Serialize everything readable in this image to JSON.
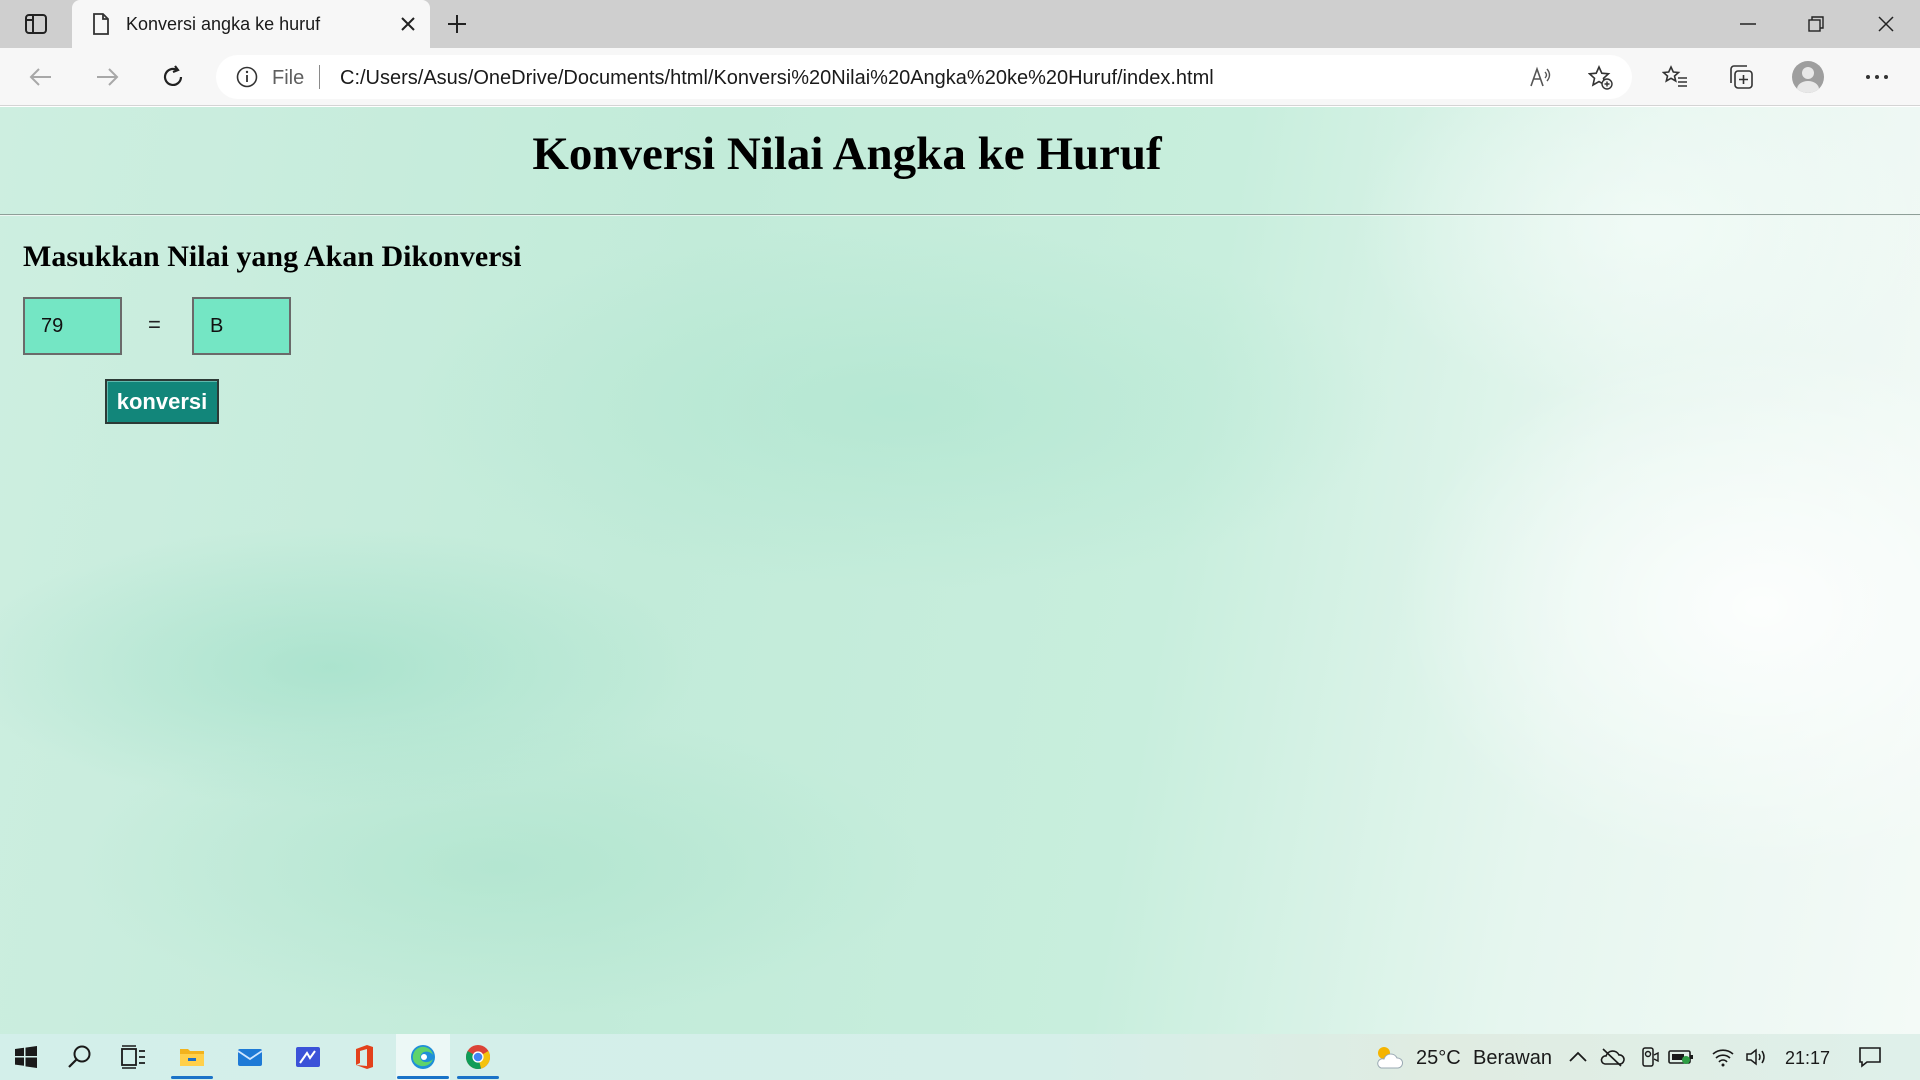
{
  "browser": {
    "tab": {
      "title": "Konversi angka ke huruf"
    },
    "address": {
      "scheme": "File",
      "url": "C:/Users/Asus/OneDrive/Documents/html/Konversi%20Nilai%20Angka%20ke%20Huruf/index.html"
    }
  },
  "page": {
    "title": "Konversi Nilai Angka ke Huruf",
    "heading": "Masukkan Nilai yang Akan Dikonversi",
    "input_value": "79",
    "equals": "=",
    "result_value": "B",
    "button_label": "konversi",
    "colors": {
      "input_bg": "#74e6c4",
      "button_bg": "#12867a",
      "button_text": "#ffffff"
    }
  },
  "taskbar": {
    "apps": [
      "start-icon",
      "search-icon",
      "task-view-icon",
      "file-explorer-icon",
      "mail-icon",
      "whiteboard-icon",
      "office-icon",
      "edge-icon",
      "chrome-icon"
    ],
    "weather": {
      "temperature": "25°C",
      "condition": "Berawan"
    },
    "clock": "21:17"
  }
}
